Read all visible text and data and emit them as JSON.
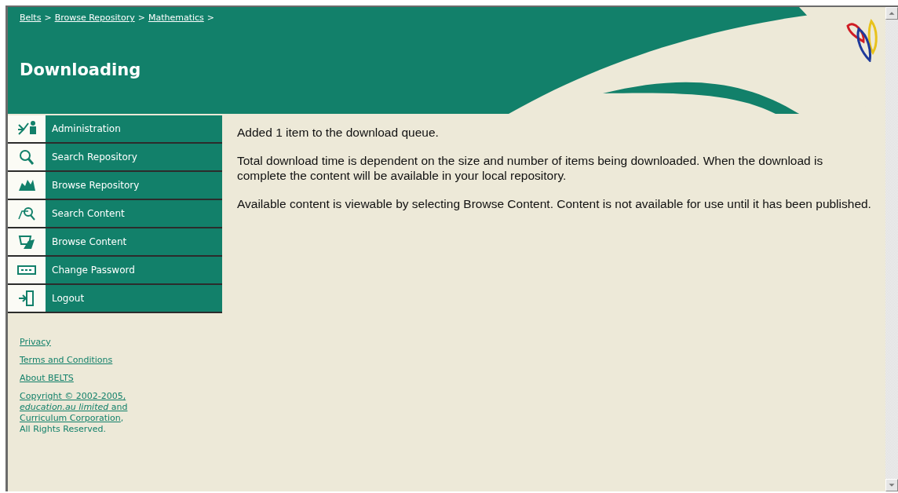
{
  "header": {
    "breadcrumb": [
      {
        "kind": "link",
        "text": "Belts"
      },
      {
        "kind": "separator",
        "text": ">"
      },
      {
        "kind": "link",
        "text": "Browse Repository"
      },
      {
        "kind": "separator",
        "text": ">"
      },
      {
        "kind": "link",
        "text": "Mathematics"
      },
      {
        "kind": "separator",
        "text": ">"
      }
    ],
    "title": "Downloading"
  },
  "sidebar": {
    "menu": [
      {
        "label": "Administration"
      },
      {
        "label": "Search Repository"
      },
      {
        "label": "Browse Repository"
      },
      {
        "label": "Search Content"
      },
      {
        "label": "Browse Content"
      },
      {
        "label": "Change Password"
      },
      {
        "label": "Logout"
      }
    ],
    "links": [
      "Privacy",
      "Terms and Conditions",
      "About BELTS"
    ],
    "copyright": [
      [
        {
          "kind": "link",
          "text": "Copyright © 2002-2005,"
        }
      ],
      [
        {
          "kind": "link",
          "text": "*education.au limited* and"
        }
      ],
      [
        {
          "kind": "link",
          "text": "Curriculum Corporation"
        },
        {
          "kind": "text",
          "text": ","
        }
      ],
      [
        {
          "kind": "text",
          "text": "All Rights Reserved."
        }
      ]
    ]
  },
  "content": {
    "paragraphs": [
      "Added 1 item to the download queue.",
      "Total download time is dependent on the size and number of items being downloaded. When the download is complete the content will be available in your local repository.",
      "Available content is viewable by selecting Browse Content. Content is not available for use until it has been published."
    ]
  }
}
